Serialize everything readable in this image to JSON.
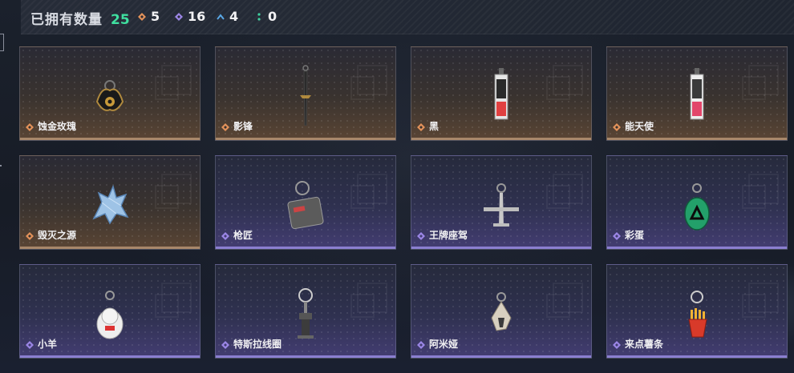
{
  "header": {
    "owned_label": "已拥有数量",
    "owned_count": "25",
    "stats": [
      {
        "icon": "gold-diamond-icon",
        "color": "#e3925a",
        "value": "5"
      },
      {
        "icon": "purple-diamond-icon",
        "color": "#9b86e6",
        "value": "16"
      },
      {
        "icon": "blue-chevron-icon",
        "color": "#5aa8e6",
        "value": "4"
      },
      {
        "icon": "green-dots-icon",
        "color": "#3fd2a0",
        "value": "0"
      }
    ]
  },
  "items": [
    {
      "name": "蚀金玫瑰",
      "rarity": "gold",
      "icon": "ornate-gear-charm-icon"
    },
    {
      "name": "影锋",
      "rarity": "gold",
      "icon": "blade-charm-icon"
    },
    {
      "name": "黑",
      "rarity": "gold",
      "icon": "card-charm-icon"
    },
    {
      "name": "能天使",
      "rarity": "gold",
      "icon": "card-charm-icon"
    },
    {
      "name": "毁灭之源",
      "rarity": "gold",
      "icon": "crystal-dragon-icon"
    },
    {
      "name": "枪匠",
      "rarity": "purple",
      "icon": "dog-tag-icon"
    },
    {
      "name": "王牌座驾",
      "rarity": "purple",
      "icon": "airplane-charm-icon"
    },
    {
      "name": "彩蛋",
      "rarity": "purple",
      "icon": "green-egg-charm-icon"
    },
    {
      "name": "小羊",
      "rarity": "purple",
      "icon": "lucky-cat-charm-icon"
    },
    {
      "name": "特斯拉线圈",
      "rarity": "purple",
      "icon": "tesla-coil-charm-icon"
    },
    {
      "name": "阿米娅",
      "rarity": "purple",
      "icon": "bunny-ears-charm-icon"
    },
    {
      "name": "来点薯条",
      "rarity": "purple",
      "icon": "fries-charm-icon"
    }
  ],
  "colors": {
    "owned_count": "#3fe0a0",
    "gold_border": "#a8876a",
    "purple_border": "#8b7fd0"
  }
}
